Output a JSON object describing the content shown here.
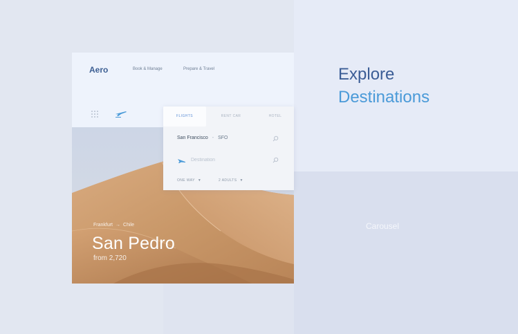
{
  "app": {
    "logo": "Aero",
    "nav": [
      "Book & Manage",
      "Prepare & Travel"
    ]
  },
  "search": {
    "tabs": [
      "FLIGHTS",
      "RENT CAR",
      "HOTEL"
    ],
    "origin_city": "San Francisco",
    "origin_separator": "-",
    "origin_code": "SFO",
    "destination_placeholder": "Destination",
    "trip_type": "ONE WAY",
    "passengers": "2 ADULTS"
  },
  "hero": {
    "route_from": "Frankfurt",
    "route_arrow": "→",
    "route_to": "Chile",
    "city": "San Pedro",
    "price": "from 2,720"
  },
  "headline": {
    "line1": "Explore",
    "line2": "Destinations"
  },
  "carousel": {
    "label": "Carousel"
  },
  "colors": {
    "accent": "#4a9ad8",
    "brand_dark": "#3b5d96",
    "background": "#e2e7f1"
  }
}
